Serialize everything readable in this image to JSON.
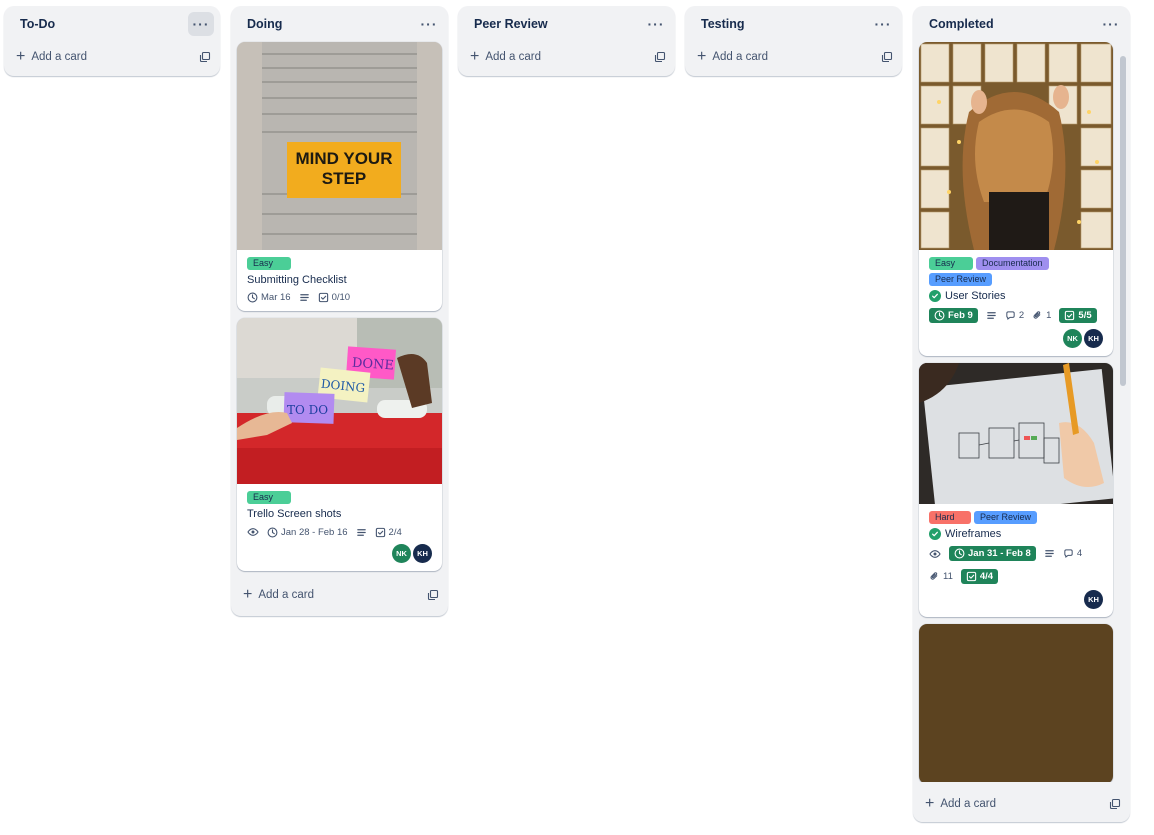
{
  "lists": [
    {
      "title": "To-Do",
      "add_label": "Add a card"
    },
    {
      "title": "Doing",
      "add_label": "Add a card"
    },
    {
      "title": "Peer Review",
      "add_label": "Add a card"
    },
    {
      "title": "Testing",
      "add_label": "Add a card"
    },
    {
      "title": "Completed",
      "add_label": "Add a card"
    }
  ],
  "menu_glyph": "···",
  "doing_cards": [
    {
      "cover_text": "MIND YOUR STEP",
      "labels": [
        "Easy"
      ],
      "title": "Submitting Checklist",
      "due": "Mar 16",
      "checklist": "0/10"
    },
    {
      "cover_notes": [
        "DONE",
        "DOING",
        "TO DO"
      ],
      "labels": [
        "Easy"
      ],
      "title": "Trello Screen shots",
      "due": "Jan 28 - Feb 16",
      "checklist": "2/4",
      "members": [
        "NK",
        "KH"
      ]
    }
  ],
  "completed_cards": [
    {
      "labels": [
        "Easy",
        "Documentation",
        "Peer Review"
      ],
      "title": "User Stories",
      "due": "Feb 9",
      "comments": "2",
      "attachments": "1",
      "checklist": "5/5",
      "members": [
        "NK",
        "KH"
      ]
    },
    {
      "labels": [
        "Hard",
        "Peer Review"
      ],
      "title": "Wireframes",
      "due": "Jan 31 - Feb 8",
      "comments": "4",
      "attachments": "11",
      "checklist": "4/4",
      "members": [
        "KH"
      ]
    },
    {
      "cover_color": "#5c4320"
    }
  ],
  "colors": {
    "easy": "#4bce97",
    "documentation": "#9f8fef",
    "peer_review": "#579dff",
    "hard": "#f87168",
    "complete_green": "#1f845a"
  }
}
